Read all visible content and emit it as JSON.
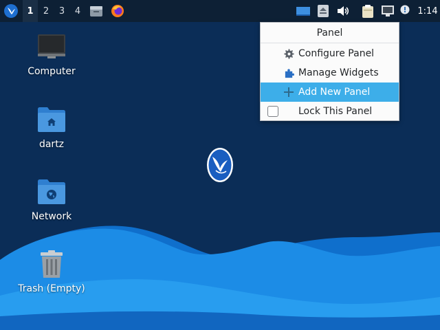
{
  "panel": {
    "workspaces": [
      "1",
      "2",
      "3",
      "4"
    ],
    "active_workspace": "1",
    "launchers": [
      "files-icon",
      "firefox-icon"
    ],
    "tray_icons": [
      "show-desktop-icon",
      "eject-icon",
      "volume-icon",
      "clipboard-icon",
      "network-icon",
      "notifications-icon"
    ],
    "clock": "1:14"
  },
  "desktop": {
    "icons": [
      {
        "label": "Computer",
        "icon": "computer-icon"
      },
      {
        "label": "dartz",
        "icon": "home-folder-icon"
      },
      {
        "label": "Network",
        "icon": "network-folder-icon"
      },
      {
        "label": "Trash (Empty)",
        "icon": "trash-icon"
      }
    ]
  },
  "context_menu": {
    "title": "Panel",
    "items": [
      {
        "label": "Configure Panel",
        "icon": "gear-icon"
      },
      {
        "label": "Manage Widgets",
        "icon": "puzzle-icon"
      },
      {
        "label": "Add New Panel",
        "icon": "plus-icon",
        "highlighted": true
      },
      {
        "label": "Lock This Panel",
        "icon": "checkbox",
        "checked": false
      }
    ]
  },
  "colors": {
    "panel_bg": "#0d2035",
    "desktop_bg": "#0b2d57",
    "wave_light": "#2aa0f0",
    "wave_mid": "#1178d6",
    "menu_highlight": "#3daee9",
    "menu_bg": "#fbfbfb"
  }
}
